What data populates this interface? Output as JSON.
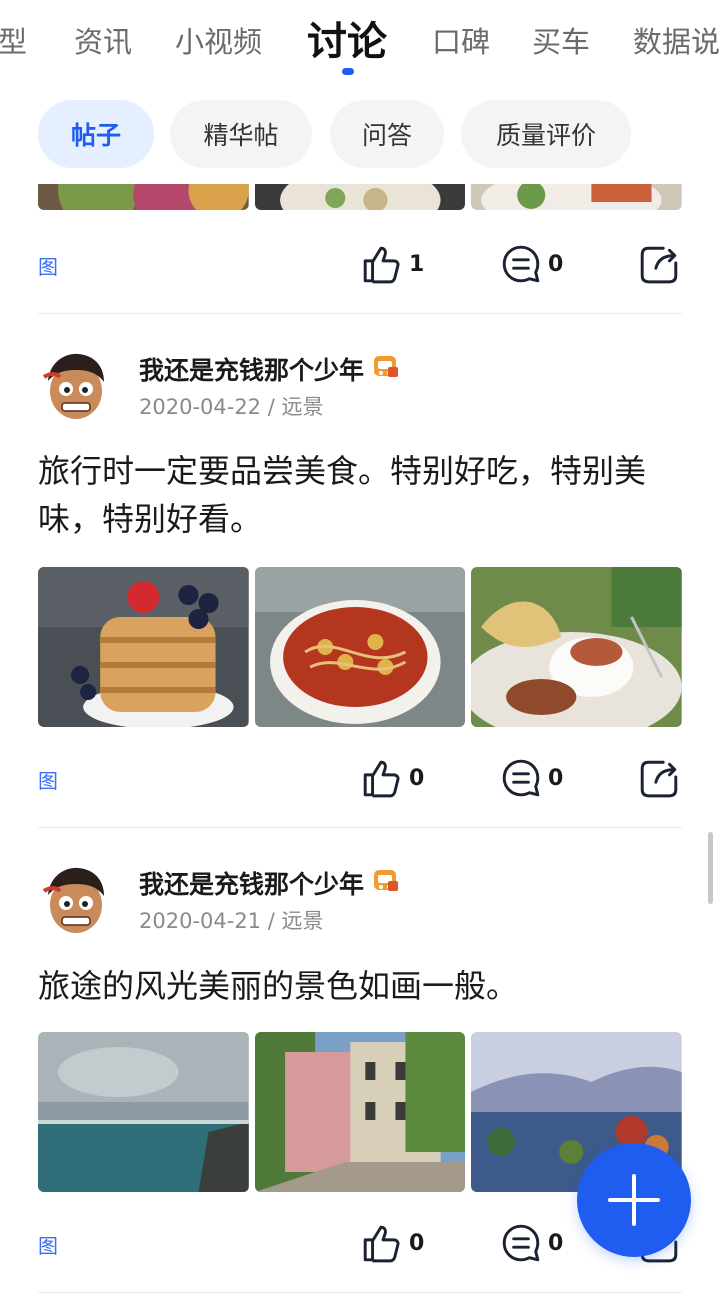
{
  "top_tabs": [
    {
      "label": "型"
    },
    {
      "label": "资讯"
    },
    {
      "label": "小视频"
    },
    {
      "label": "讨论"
    },
    {
      "label": "口碑"
    },
    {
      "label": "买车"
    },
    {
      "label": "数据说"
    }
  ],
  "active_top_tab": "讨论",
  "sub_tabs": [
    {
      "label": "帖子"
    },
    {
      "label": "精华帖"
    },
    {
      "label": "问答"
    },
    {
      "label": "质量评价"
    }
  ],
  "active_sub_tab": "帖子",
  "colors": {
    "accent": "#1f5cf0",
    "chip_active_bg": "#e6efff",
    "tag": "#3a6ff2"
  },
  "icons": {
    "like": "thumbs-up-icon",
    "comment": "comment-icon",
    "share": "share-icon",
    "add": "plus-icon",
    "vip": "vip-badge-icon"
  },
  "posts": [
    {
      "partial": true,
      "tag": "图",
      "likes": "1",
      "comments": "0"
    },
    {
      "author": "我还是充钱那个少年",
      "date": "2020-04-22",
      "separator": "/",
      "location": "远景",
      "text": "旅行时一定要品尝美食。特别好吃，特别美味，特别好看。",
      "tag": "图",
      "likes": "0",
      "comments": "0"
    },
    {
      "author": "我还是充钱那个少年",
      "date": "2020-04-21",
      "separator": "/",
      "location": "远景",
      "text": "旅途的风光美丽的景色如画一般。",
      "tag": "图",
      "likes": "0",
      "comments": "0"
    }
  ]
}
